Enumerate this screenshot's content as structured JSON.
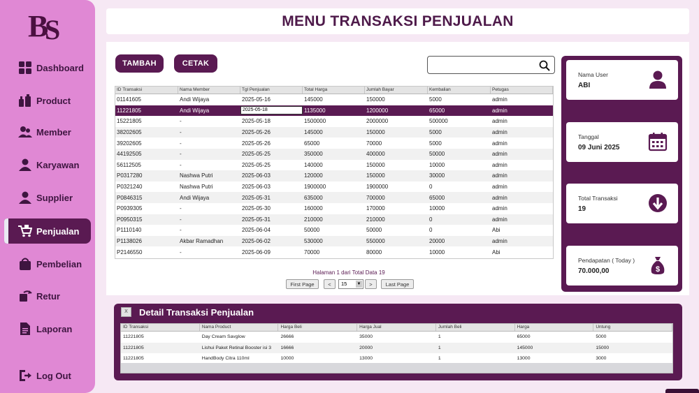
{
  "sidebar": {
    "logo_text": "BS",
    "items": [
      {
        "label": "Dashboard",
        "icon": "dashboard-icon"
      },
      {
        "label": "Product",
        "icon": "product-icon"
      },
      {
        "label": "Member",
        "icon": "member-icon"
      },
      {
        "label": "Karyawan",
        "icon": "karyawan-icon"
      },
      {
        "label": "Supplier",
        "icon": "supplier-icon"
      },
      {
        "label": "Penjualan",
        "icon": "cart-icon",
        "active": true
      },
      {
        "label": "Pembelian",
        "icon": "shopping-bag-icon"
      },
      {
        "label": "Retur",
        "icon": "retur-icon"
      },
      {
        "label": "Laporan",
        "icon": "report-icon"
      }
    ],
    "logout_label": "Log Out"
  },
  "header": {
    "title": "MENU TRANSAKSI PENJUALAN"
  },
  "toolbar": {
    "add_label": "TAMBAH",
    "print_label": "CETAK",
    "search_value": ""
  },
  "transactions": {
    "columns": [
      "ID Transaksi",
      "Nama Member",
      "Tgl Penjualan",
      "Total Harga",
      "Jumlah Bayar",
      "Kembalian",
      "Petugas"
    ],
    "rows": [
      [
        "01141605",
        "Andi Wijaya",
        "2025-05-16",
        "145000",
        "150000",
        "5000",
        "admin"
      ],
      [
        "11221805",
        "Andi Wijaya",
        "2025-05-18",
        "1135000",
        "1200000",
        "65000",
        "admin"
      ],
      [
        "15221805",
        "-",
        "2025-05-18",
        "1500000",
        "2000000",
        "500000",
        "admin"
      ],
      [
        "38202605",
        "-",
        "2025-05-26",
        "145000",
        "150000",
        "5000",
        "admin"
      ],
      [
        "39202605",
        "-",
        "2025-05-26",
        "65000",
        "70000",
        "5000",
        "admin"
      ],
      [
        "44192505",
        "-",
        "2025-05-25",
        "350000",
        "400000",
        "50000",
        "admin"
      ],
      [
        "56112505",
        "-",
        "2025-05-25",
        "140000",
        "150000",
        "10000",
        "admin"
      ],
      [
        "P0317280",
        "Nashwa Putri",
        "2025-06-03",
        "120000",
        "150000",
        "30000",
        "admin"
      ],
      [
        "P0321240",
        "Nashwa Putri",
        "2025-06-03",
        "1900000",
        "1900000",
        "0",
        "admin"
      ],
      [
        "P0846315",
        "Andi Wijaya",
        "2025-05-31",
        "635000",
        "700000",
        "65000",
        "admin"
      ],
      [
        "P0939305",
        "-",
        "2025-05-30",
        "160000",
        "170000",
        "10000",
        "admin"
      ],
      [
        "P0950315",
        "-",
        "2025-05-31",
        "210000",
        "210000",
        "0",
        "admin"
      ],
      [
        "P1110140",
        "-",
        "2025-06-04",
        "50000",
        "50000",
        "0",
        "Abi"
      ],
      [
        "P1138026",
        "Akbar Ramadhan",
        "2025-06-02",
        "530000",
        "550000",
        "20000",
        "admin"
      ],
      [
        "P2146550",
        "-",
        "2025-06-09",
        "70000",
        "80000",
        "10000",
        "Abi"
      ]
    ],
    "selected_row": 1
  },
  "pagination": {
    "info": "Halaman 1 dari Total Data 19",
    "first_label": "First Page",
    "prev_label": "<",
    "page_size": "15",
    "next_label": ">",
    "last_label": "Last Page"
  },
  "stats": {
    "user": {
      "label": "Nama User",
      "value": "ABI",
      "icon": "user-icon"
    },
    "date": {
      "label": "Tanggal",
      "value": "09 Juni 2025",
      "icon": "calendar-icon"
    },
    "total": {
      "label": "Total Transaksi",
      "value": "19",
      "icon": "arrow-down-circle-icon"
    },
    "income": {
      "label": "Pendapatan ( Today )",
      "value": "70.000,00",
      "icon": "money-bag-icon"
    }
  },
  "detail": {
    "close_label": "X",
    "title": "Detail Transaksi Penjualan",
    "columns": [
      "ID Transaksi",
      "Nama Product",
      "Harga Beli",
      "Harga Jual",
      "Jumlah Beli",
      "Harga",
      "Untung"
    ],
    "rows": [
      [
        "11221805",
        "Day Cream Savglow",
        "26666",
        "35000",
        "1",
        "65000",
        "5000"
      ],
      [
        "11221805",
        "Lishui Paket Retinal Booster isi 3",
        "16666",
        "20000",
        "1",
        "145000",
        "15000"
      ],
      [
        "11221805",
        "HandBody Citra 110ml",
        "10000",
        "13000",
        "1",
        "13000",
        "3000"
      ]
    ]
  },
  "colors": {
    "primary": "#5a1a52",
    "sidebar": "#e088d4",
    "background": "#f6e8f4"
  }
}
